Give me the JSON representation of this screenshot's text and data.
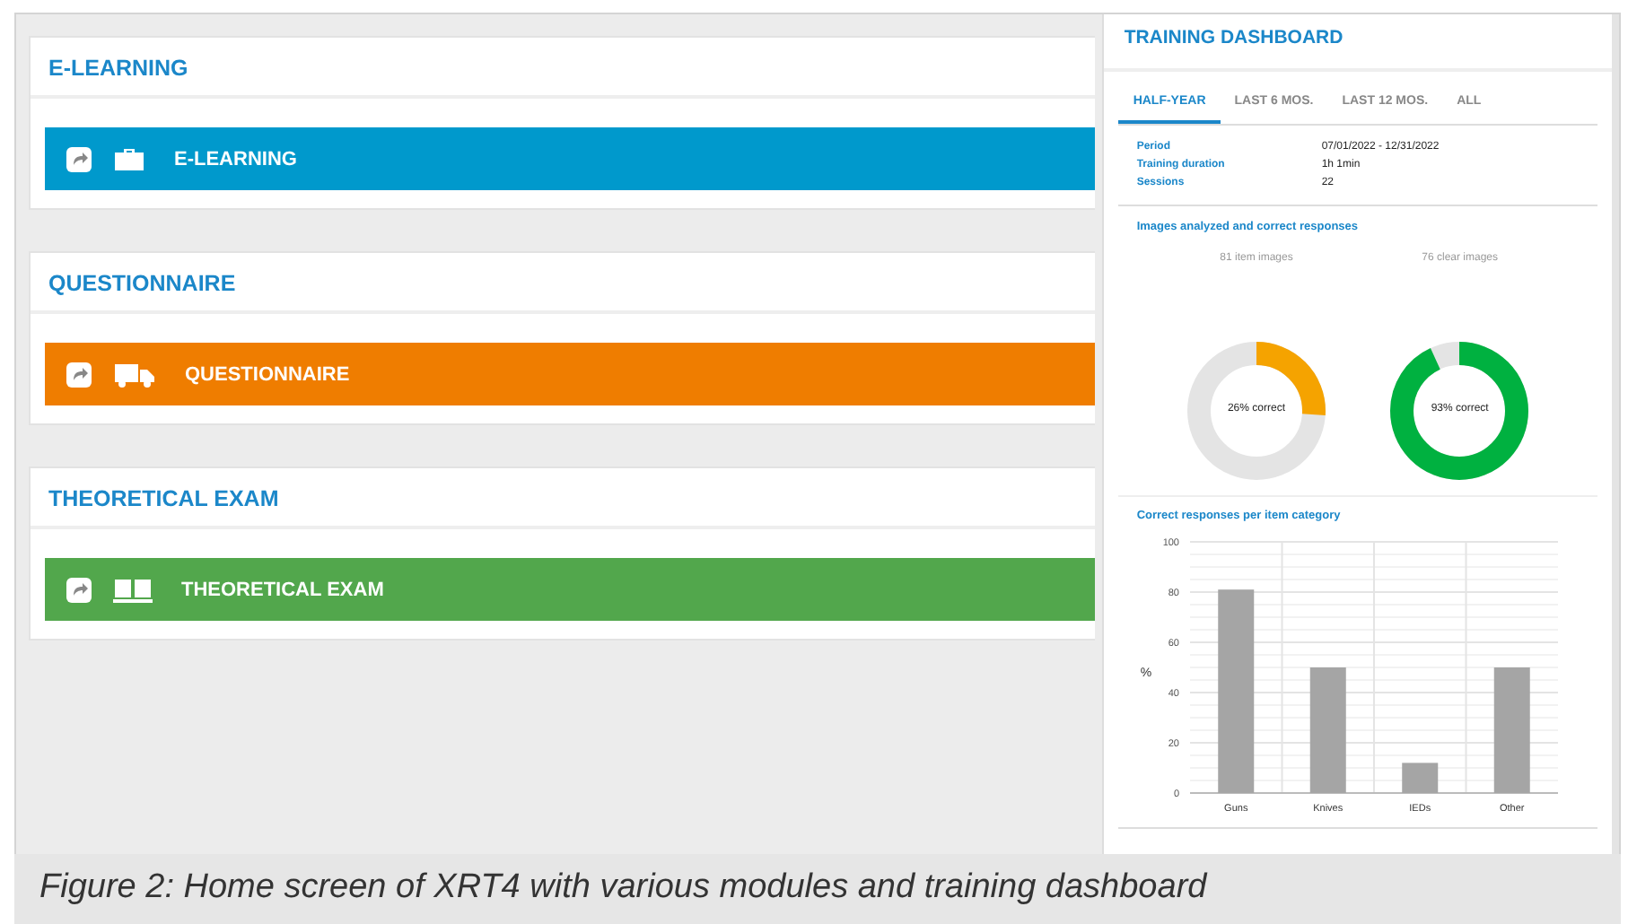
{
  "modules": [
    {
      "heading": "E-LEARNING",
      "button": "E-LEARNING",
      "kind": "briefcase",
      "color": "#0099cc"
    },
    {
      "heading": "QUESTIONNAIRE",
      "button": "QUESTIONNAIRE",
      "kind": "truck",
      "color": "#ef7d00"
    },
    {
      "heading": "THEORETICAL EXAM",
      "button": "THEORETICAL EXAM",
      "kind": "book",
      "color": "#52a74c"
    }
  ],
  "dashboard": {
    "title": "TRAINING DASHBOARD",
    "tabs": [
      {
        "label": "HALF-YEAR",
        "selected": true
      },
      {
        "label": "LAST 6 MOS.",
        "selected": false
      },
      {
        "label": "LAST 12 MOS.",
        "selected": false
      },
      {
        "label": "ALL",
        "selected": false
      }
    ],
    "info": [
      {
        "label": "Period",
        "value": "07/01/2022 - 12/31/2022"
      },
      {
        "label": "Training duration",
        "value": "1h 1min"
      },
      {
        "label": "Sessions",
        "value": "22"
      }
    ],
    "images_title": "Images analyzed and correct responses",
    "donuts": [
      {
        "caption": "81 item images",
        "reading": "26% correct",
        "color": "#f5a300"
      },
      {
        "caption": "76 clear images",
        "reading": "93% correct",
        "color": "#00b140"
      }
    ],
    "chart_data": {
      "type": "bar",
      "title": "Correct responses per item category",
      "ylabel": "%",
      "categories": [
        "Guns",
        "Knives",
        "IEDs",
        "Other"
      ],
      "values": [
        81,
        50,
        12,
        50
      ],
      "ylim": [
        0,
        100
      ],
      "grid": true,
      "yticks": [
        0,
        20,
        40,
        60,
        80,
        100
      ]
    }
  },
  "caption": "Figure 2: Home screen of XRT4 with various modules and training dashboard"
}
